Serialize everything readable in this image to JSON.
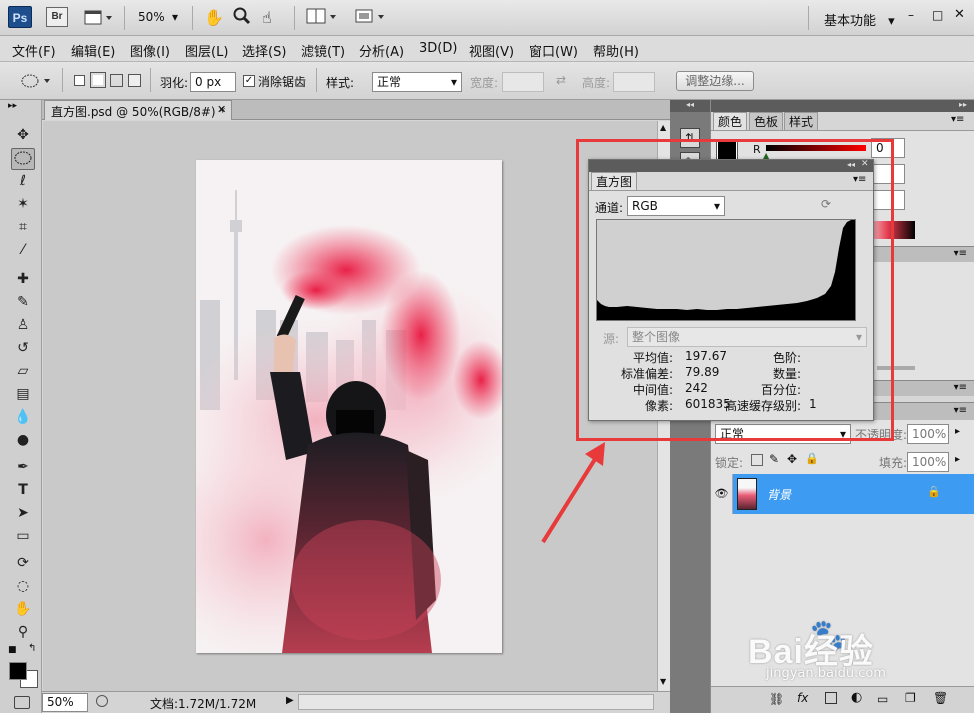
{
  "app": {
    "logo": "Ps",
    "bridge_logo": "Br",
    "zoom_select": "50%",
    "workspace": "基本功能"
  },
  "menu": [
    {
      "label": "文件(F)"
    },
    {
      "label": "编辑(E)"
    },
    {
      "label": "图像(I)"
    },
    {
      "label": "图层(L)"
    },
    {
      "label": "选择(S)"
    },
    {
      "label": "滤镜(T)"
    },
    {
      "label": "分析(A)"
    },
    {
      "label": "3D(D)"
    },
    {
      "label": "视图(V)"
    },
    {
      "label": "窗口(W)"
    },
    {
      "label": "帮助(H)"
    }
  ],
  "options": {
    "feather_label": "羽化:",
    "feather_value": "0 px",
    "antialias_label": "消除锯齿",
    "style_label": "样式:",
    "style_value": "正常",
    "width_label": "宽度:",
    "height_label": "高度:",
    "refine_edge": "调整边缘..."
  },
  "document": {
    "tab_title": "直方图.psd @ 50%(RGB/8#) *",
    "zoom": "50%",
    "doc_info": "文档:1.72M/1.72M"
  },
  "panels": {
    "tabs_top": [
      {
        "label": "颜色"
      },
      {
        "label": "色板"
      },
      {
        "label": "样式"
      }
    ],
    "color_r_label": "R",
    "color_r_value": "0",
    "layers_mode": "正常",
    "layers_opacity_label": "不透明度:",
    "layers_opacity": "100%",
    "layers_lock_label": "锁定:",
    "layers_fill_label": "填充:",
    "layers_fill": "100%",
    "layer_name": "背景"
  },
  "histogram": {
    "title": "直方图",
    "channel_label": "通道:",
    "channel_value": "RGB",
    "source_label": "源:",
    "source_value": "整个图像",
    "stats_left": [
      {
        "label": "平均值:",
        "value": "197.67"
      },
      {
        "label": "标准偏差:",
        "value": "79.89"
      },
      {
        "label": "中间值:",
        "value": "242"
      },
      {
        "label": "像素:",
        "value": "601835"
      }
    ],
    "stats_right": [
      {
        "label": "色阶:",
        "value": ""
      },
      {
        "label": "数量:",
        "value": ""
      },
      {
        "label": "百分位:",
        "value": ""
      },
      {
        "label": "高速缓存级别:",
        "value": "1"
      }
    ]
  },
  "watermark": {
    "brand": "Bai经验",
    "url": "jingyan.baidu.com"
  },
  "colors": {
    "highlight": "#e83a3a",
    "layer_selected": "#3d9bf2"
  }
}
